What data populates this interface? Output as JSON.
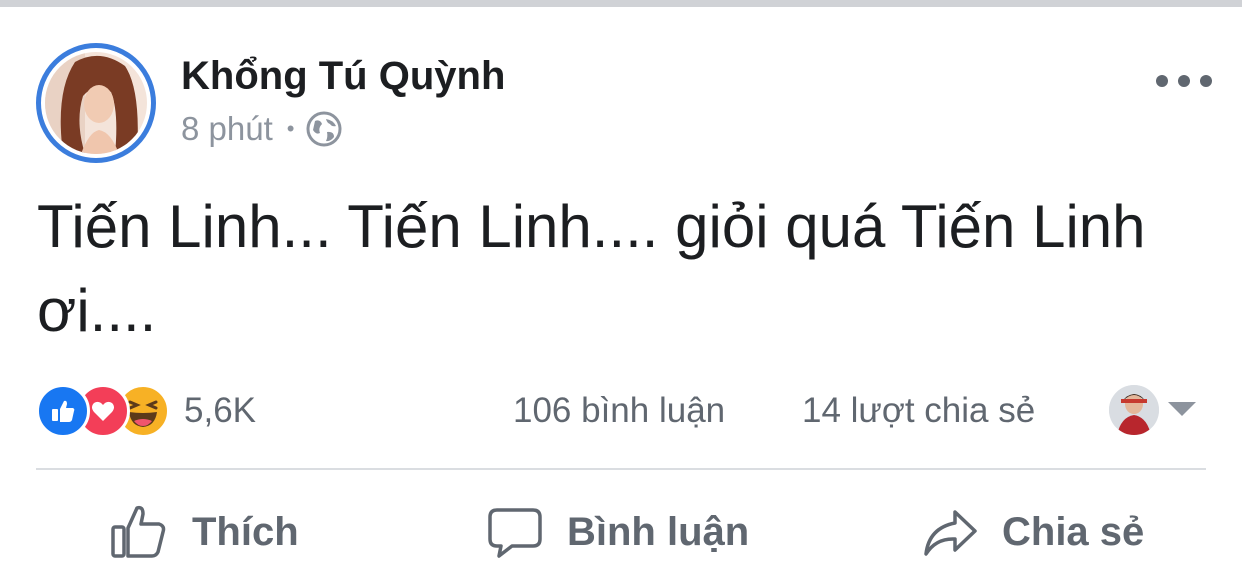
{
  "post": {
    "author": "Khổng Tú Quỳnh",
    "time": "8 phút",
    "separator": "•",
    "privacy_icon": "globe-icon",
    "text": "Tiến Linh... Tiến Linh.... giỏi quá Tiến Linh ơi....",
    "more_icon": "more-options-icon"
  },
  "reactions": {
    "types": [
      "like",
      "love",
      "haha"
    ],
    "count": "5,6K"
  },
  "stats": {
    "comments": "106 bình luận",
    "shares": "14 lượt chia sẻ"
  },
  "actions": {
    "like": "Thích",
    "comment": "Bình luận",
    "share": "Chia sẻ"
  },
  "colors": {
    "accent": "#1877f2",
    "avatar_ring": "#3b7ddd",
    "secondary_text": "#606770",
    "love": "#f33e58",
    "haha": "#f7b125"
  }
}
